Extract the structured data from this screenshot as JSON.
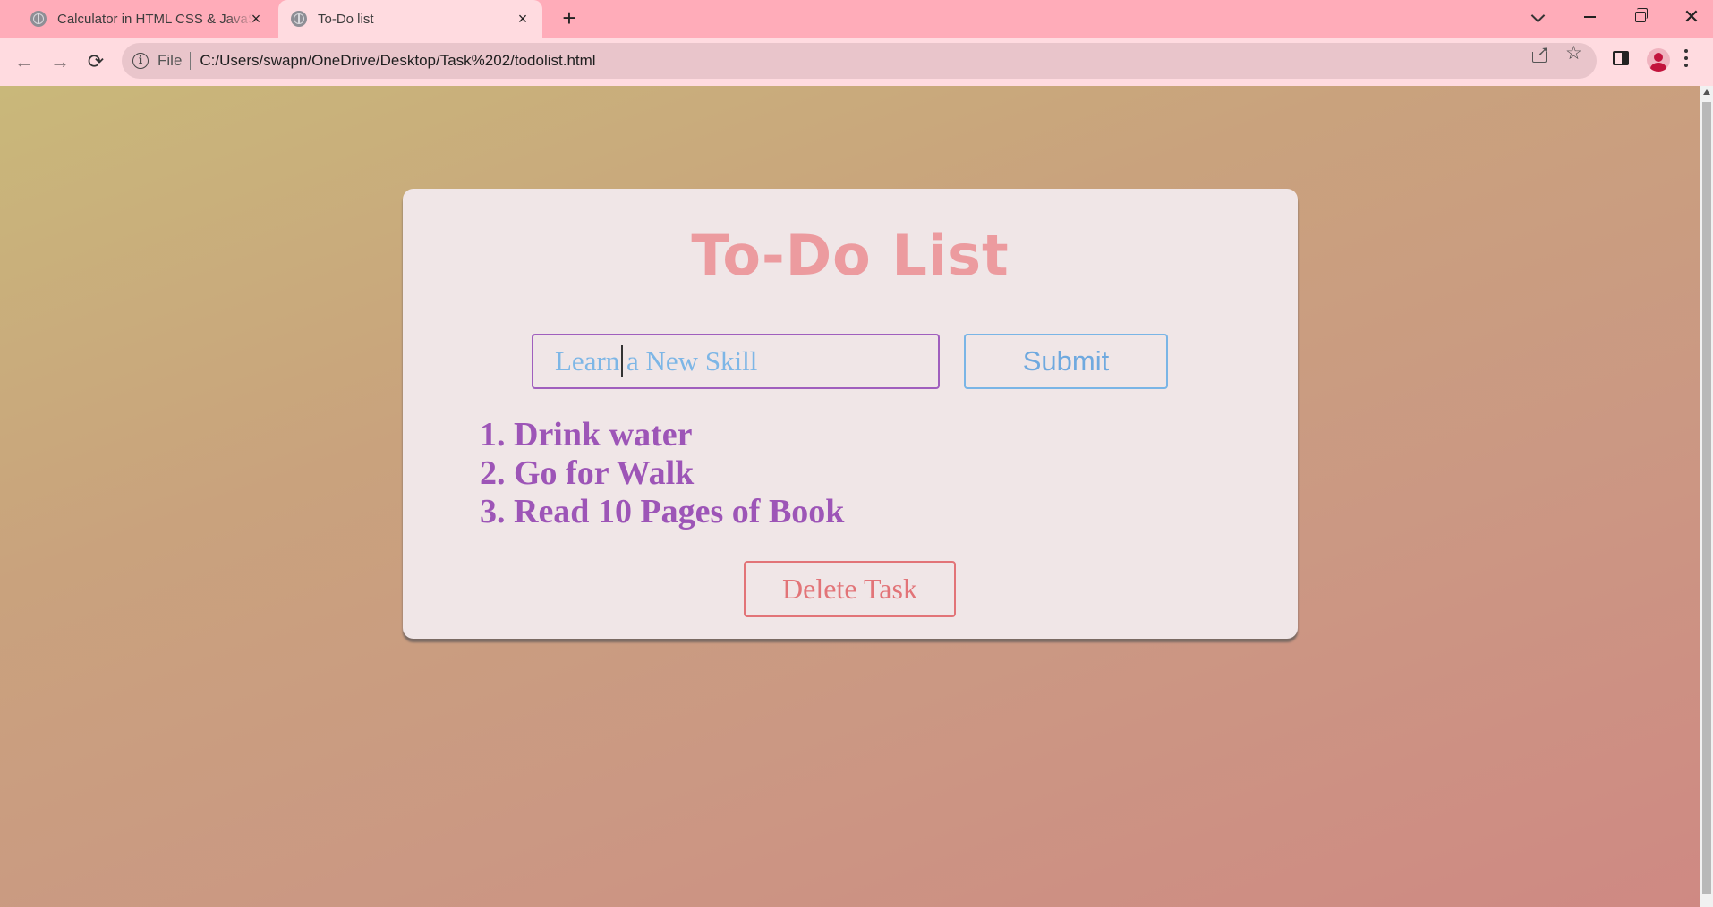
{
  "browser": {
    "tabs": [
      {
        "title": "Calculator in HTML CSS & JavaScript",
        "active": false,
        "close_glyph": "×"
      },
      {
        "title": "To-Do list",
        "active": true,
        "close_glyph": "×"
      }
    ],
    "new_tab_glyph": "+",
    "window_close_glyph": "✕",
    "nav": {
      "back_glyph": "←",
      "forward_glyph": "→",
      "reload_glyph": "⟳"
    },
    "address": {
      "scheme_label": "File",
      "url": "C:/Users/swapn/OneDrive/Desktop/Task%202/todolist.html"
    },
    "icons": [
      "tab-favicon-icon",
      "tab-search-icon",
      "minimize-icon",
      "restore-icon",
      "close-icon",
      "back-icon",
      "forward-icon",
      "reload-icon",
      "site-info-icon",
      "share-icon",
      "bookmark-star-icon",
      "side-panel-icon",
      "profile-avatar-icon",
      "menu-icon"
    ],
    "star_glyph": "☆",
    "site_info_glyph": "i"
  },
  "page": {
    "title": "To-Do List",
    "input": {
      "value": "",
      "placeholder": "Learn a New Skill"
    },
    "submit_label": "Submit",
    "tasks": [
      {
        "number": "1.",
        "text": "Drink water"
      },
      {
        "number": "2.",
        "text": "Go for Walk"
      },
      {
        "number": "3.",
        "text": "Read 10 Pages of Book"
      }
    ],
    "delete_label": "Delete Task"
  },
  "colors": {
    "title": "#ec9b9f",
    "input_border": "#a05fbe",
    "placeholder": "#7db6e6",
    "submit": "#6fa9df",
    "task_text": "#9d55b7",
    "delete": "#e27478",
    "card_bg": "#f0e6e7",
    "tabstrip_bg": "#ffacb9",
    "toolbar_bg": "#ffdbe0"
  }
}
